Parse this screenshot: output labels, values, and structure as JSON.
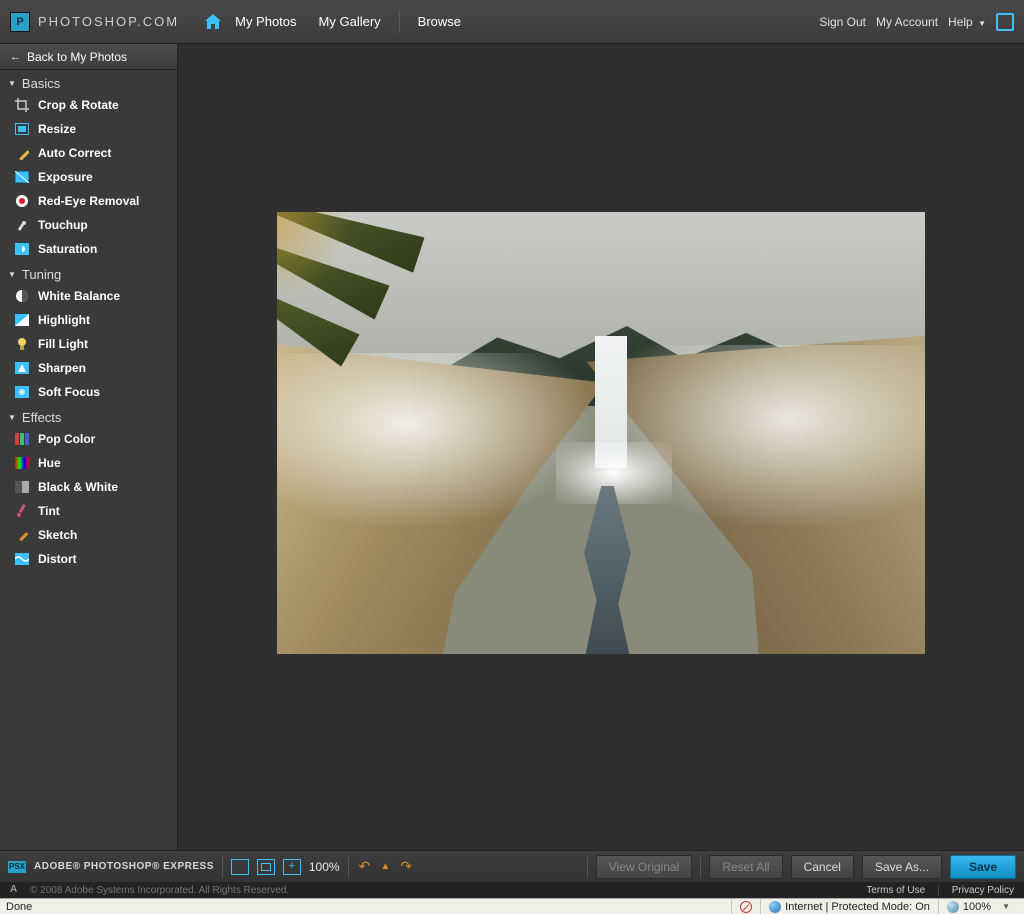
{
  "brand": "PHOTOSHOP.COM",
  "topnav": {
    "myPhotos": "My Photos",
    "myGallery": "My Gallery",
    "browse": "Browse"
  },
  "topright": {
    "signOut": "Sign Out",
    "myAccount": "My Account",
    "help": "Help"
  },
  "back": "Back to My Photos",
  "sections": {
    "basics": {
      "title": "Basics",
      "tools": [
        "Crop & Rotate",
        "Resize",
        "Auto Correct",
        "Exposure",
        "Red-Eye Removal",
        "Touchup",
        "Saturation"
      ]
    },
    "tuning": {
      "title": "Tuning",
      "tools": [
        "White Balance",
        "Highlight",
        "Fill Light",
        "Sharpen",
        "Soft Focus"
      ]
    },
    "effects": {
      "title": "Effects",
      "tools": [
        "Pop Color",
        "Hue",
        "Black & White",
        "Tint",
        "Sketch",
        "Distort"
      ]
    }
  },
  "bottom": {
    "product": "ADOBE® PHOTOSHOP® EXPRESS",
    "zoom": "100%",
    "viewOriginal": "View Original",
    "resetAll": "Reset All",
    "cancel": "Cancel",
    "saveAs": "Save As...",
    "save": "Save"
  },
  "footer": {
    "copyright": "© 2008 Adobe Systems Incorporated. All Rights Reserved.",
    "terms": "Terms of Use",
    "privacy": "Privacy Policy"
  },
  "status": {
    "done": "Done",
    "zone": "Internet | Protected Mode: On",
    "zoom": "100%"
  }
}
